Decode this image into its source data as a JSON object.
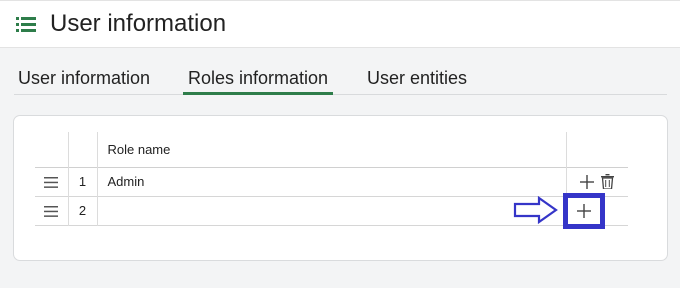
{
  "header": {
    "title": "User information",
    "menu_icon": "list-menu-icon",
    "accent_color": "#2e7d4a"
  },
  "tabs": [
    {
      "label": "User information",
      "active": false
    },
    {
      "label": "Roles information",
      "active": true
    },
    {
      "label": "User entities",
      "active": false
    }
  ],
  "grid": {
    "columns": [
      "",
      "",
      "Role name",
      ""
    ],
    "rows": [
      {
        "num": "1",
        "role_name": "Admin",
        "actions": [
          "plus-icon",
          "trash-icon"
        ]
      },
      {
        "num": "2",
        "role_name": "",
        "actions": [
          "plus-icon"
        ]
      }
    ]
  },
  "annotation": {
    "arrow_icon": "right-arrow-icon",
    "highlight_color": "#3535c8"
  }
}
